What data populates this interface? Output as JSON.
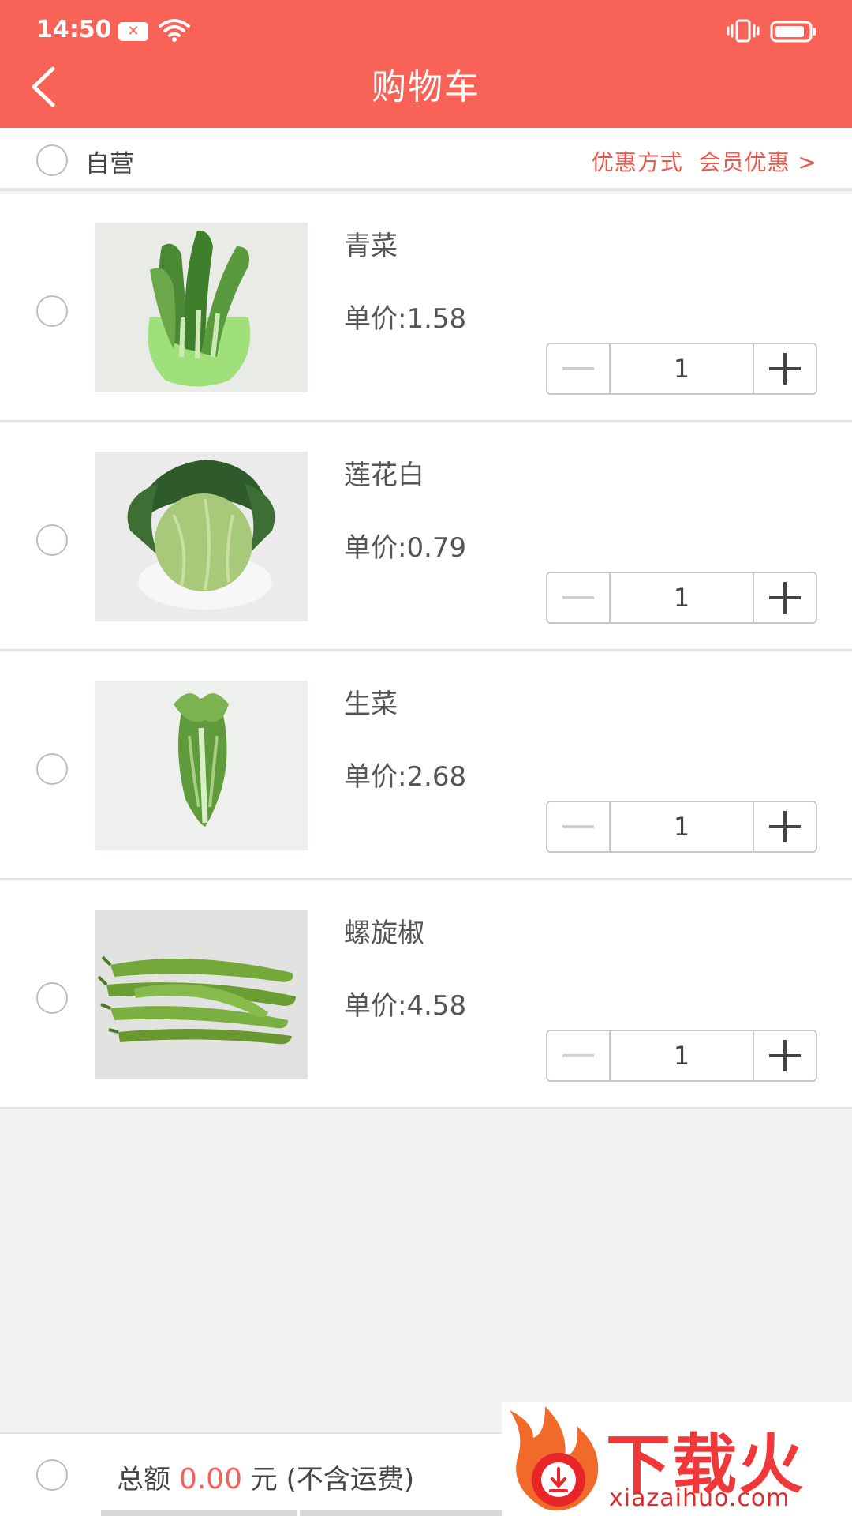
{
  "status": {
    "time": "14:50"
  },
  "header": {
    "title": "购物车"
  },
  "shop": {
    "name": "自营",
    "discount_label": "优惠方式",
    "discount_value": "会员优惠 >"
  },
  "items": [
    {
      "name": "青菜",
      "price": "单价:1.58",
      "qty": "1",
      "image": "bok-choy"
    },
    {
      "name": "莲花白",
      "price": "单价:0.79",
      "qty": "1",
      "image": "cabbage"
    },
    {
      "name": "生菜",
      "price": "单价:2.68",
      "qty": "1",
      "image": "lettuce"
    },
    {
      "name": "螺旋椒",
      "price": "单价:4.58",
      "qty": "1",
      "image": "green-peppers"
    }
  ],
  "footer": {
    "total_label": "总额",
    "total_amount": "0.00",
    "total_unit": "元 (不含运费)"
  },
  "watermark": {
    "cn": "下载火",
    "en": "xiazaihuo.com"
  },
  "colors": {
    "accent": "#f96256",
    "price_red": "#f0625a"
  }
}
